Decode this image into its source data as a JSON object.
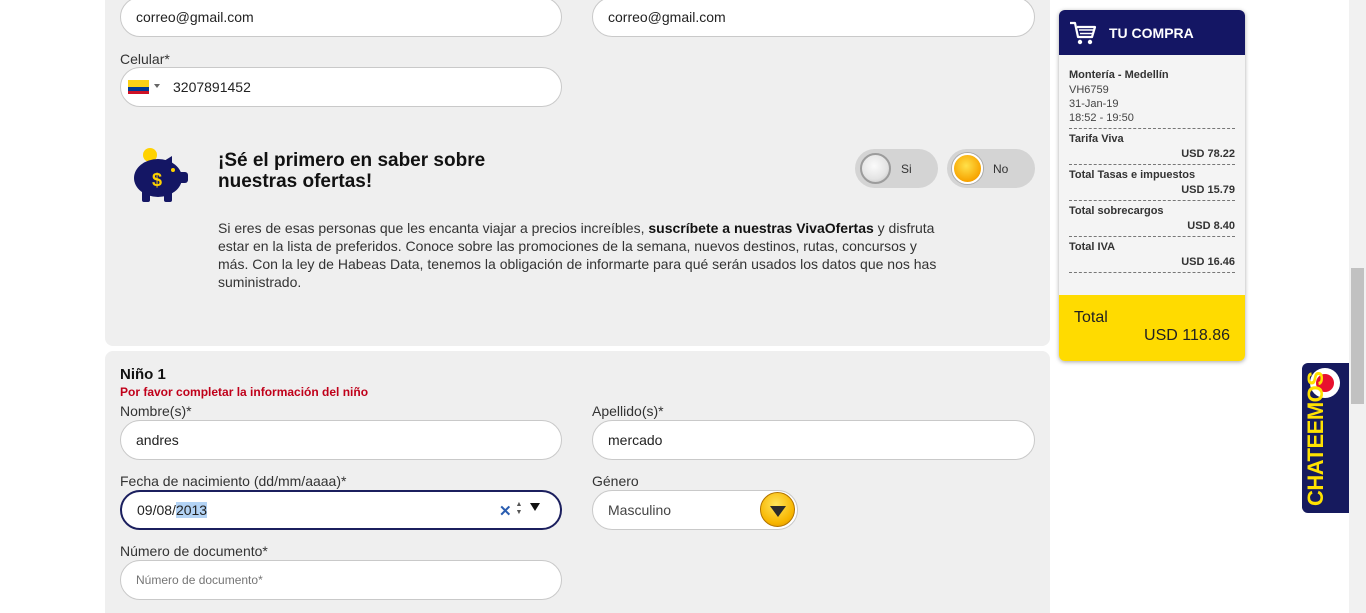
{
  "form": {
    "email1": "correo@gmail.com",
    "email2": "correo@gmail.com",
    "celular_label": "Celular*",
    "celular_value": "3207891452",
    "promo": {
      "title": "¡Sé el primero en saber sobre nuestras ofertas!",
      "text_a": "Si eres de esas personas que les encanta viajar a precios increíbles, ",
      "text_bold": "suscríbete a nuestras VivaOfertas",
      "text_b": " y disfruta estar en la lista de preferidos.  Conoce sobre las promociones de la semana, nuevos destinos, rutas, concursos y más. Con la ley de Habeas Data, tenemos la obligación de informarte para qué serán usados los datos que nos has suministrado.",
      "si_label": "Si",
      "no_label": "No",
      "selected": "No"
    },
    "nino": {
      "heading": "Niño 1",
      "warning": "Por favor completar la información del niño",
      "nombre_label": "Nombre(s)*",
      "nombre_value": "andres",
      "apellido_label": "Apellido(s)*",
      "apellido_value": "mercado",
      "fecha_label": "Fecha de nacimiento (dd/mm/aaaa)*",
      "fecha_prefix": "09/08/",
      "fecha_year": "2013",
      "genero_label": "Género",
      "genero_value": "Masculino",
      "documento_label": "Número de documento*",
      "documento_placeholder": "Número de documento*"
    }
  },
  "cart": {
    "title": "TU COMPRA",
    "route": "Montería - Medellín",
    "flight": "VH6759",
    "date": "31-Jan-19",
    "time": "18:52 - 19:50",
    "lines": [
      {
        "label": "Tarifa Viva",
        "value": "USD 78.22"
      },
      {
        "label": "Total Tasas e impuestos",
        "value": "USD 15.79"
      },
      {
        "label": "Total sobrecargos",
        "value": "USD 8.40"
      },
      {
        "label": "Total IVA",
        "value": "USD 16.46"
      }
    ],
    "total_label": "Total",
    "total_value": "USD 118.86"
  },
  "chat": {
    "label": "CHATEEMOS"
  },
  "colors": {
    "brand_navy": "#141664",
    "brand_yellow": "#ffdb00",
    "warning_red": "#c0001a"
  }
}
